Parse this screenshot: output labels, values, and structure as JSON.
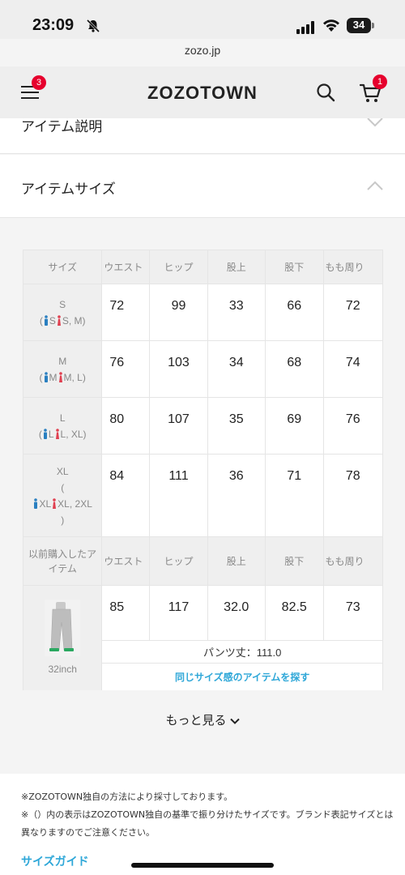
{
  "status": {
    "time": "23:09",
    "battery": "34"
  },
  "browser": {
    "url": "zozo.jp"
  },
  "header": {
    "logo": "ZOZOTOWN",
    "menu_badge": "3",
    "cart_badge": "1"
  },
  "sections": {
    "item_description": "アイテム説明",
    "item_size": "アイテムサイズ"
  },
  "size_table": {
    "columns": [
      "サイズ",
      "ウエスト",
      "ヒップ",
      "股上",
      "股下",
      "もも周り"
    ],
    "rows": [
      {
        "size": "S",
        "guide_open": "(",
        "guide_a": "S",
        "guide_b": "S, M",
        "guide_close": ")",
        "values": [
          "72",
          "99",
          "33",
          "66",
          "72"
        ]
      },
      {
        "size": "M",
        "guide_open": "(",
        "guide_a": "M",
        "guide_b": "M, L",
        "guide_close": ")",
        "values": [
          "76",
          "103",
          "34",
          "68",
          "74"
        ]
      },
      {
        "size": "L",
        "guide_open": "(",
        "guide_a": "L",
        "guide_b": "L, XL",
        "guide_close": ")",
        "values": [
          "80",
          "107",
          "35",
          "69",
          "76"
        ]
      },
      {
        "size": "XL",
        "guide_open": "(",
        "guide_a": "XL",
        "guide_b": "XL, 2XL",
        "guide_close": ")",
        "values": [
          "84",
          "111",
          "36",
          "71",
          "78"
        ]
      }
    ],
    "previous": {
      "label": "以前購入したアイテム",
      "columns": [
        "ウエスト",
        "ヒップ",
        "股上",
        "股下",
        "もも周り"
      ],
      "size_label": "32inch",
      "values": [
        "85",
        "117",
        "32.0",
        "82.5",
        "73"
      ],
      "pants_length": "パンツ丈：111.0",
      "same_size_link": "同じサイズ感のアイテムを探す"
    }
  },
  "more_button": "もっと見る",
  "notes": [
    "※ZOZOTOWN独自の方法により採寸しております。",
    "※（）内の表示はZOZOTOWN独自の基準で振り分けたサイズです。ブランド表記サイズとは異なりますのでご注意ください。"
  ],
  "size_guide": "サイズガイド",
  "colors": {
    "accent": "#2ea7d8",
    "badge": "#e6002d",
    "male_icon": "#2a7fc0",
    "female_icon": "#e04050"
  }
}
